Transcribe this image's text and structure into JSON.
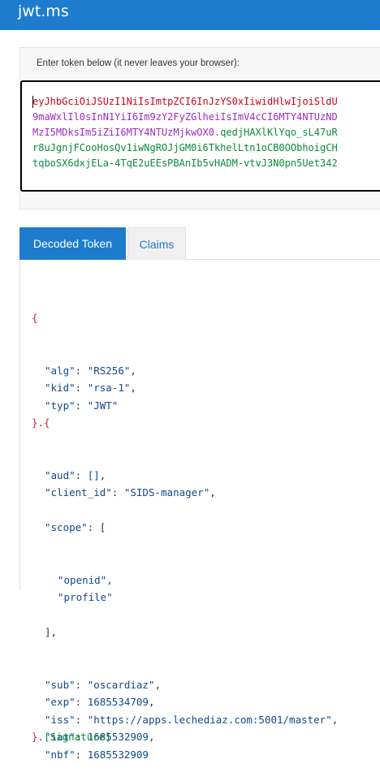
{
  "app": {
    "title": "jwt.ms"
  },
  "token": {
    "label": "Enter token below (it never leaves your browser):",
    "lines": [
      {
        "segments": [
          {
            "text": "eyJhbGciOiJSUzI1NiIsImtpZCI6InJzYS0xIiwidHlwIjoiSldU",
            "color": "red"
          }
        ]
      },
      {
        "segments": [
          {
            "text": "9maWxlIl0sInN1YiI6Im9zY2FyZGlheiIsImV4cCI6MTY4NTUzND",
            "color": "purple"
          }
        ]
      },
      {
        "segments": [
          {
            "text": "MzI5MDksIm5iZiI6MTY4NTUzMjkwOX0.",
            "color": "purple"
          },
          {
            "text": "qedjHAXlKlYqo_sL47uR",
            "color": "green"
          }
        ]
      },
      {
        "segments": [
          {
            "text": "r8uJgnjFCooHosQv1iwNgROJjGM0i6TkhelLtn1oCB0OObhoigCH",
            "color": "green"
          }
        ]
      },
      {
        "segments": [
          {
            "text": "tqboSX6dxjELa-4TqE2uEEsPBAnIb5vHADM-vtvJ3N0pn5Uet342",
            "color": "green"
          }
        ]
      }
    ]
  },
  "tabs": {
    "decoded": "Decoded Token",
    "claims": "Claims"
  },
  "decoded": {
    "open_brace": "{",
    "header": [
      {
        "key": "\"alg\"",
        "value": "\"RS256\"",
        "trail": ","
      },
      {
        "key": "\"kid\"",
        "value": "\"rsa-1\"",
        "trail": ","
      },
      {
        "key": "\"typ\"",
        "value": "\"JWT\"",
        "trail": ""
      }
    ],
    "header_close": "}.{",
    "payload_before_scope": [
      {
        "key": "\"aud\"",
        "value": "[]",
        "trail": ","
      },
      {
        "key": "\"client_id\"",
        "value": "\"SIDS-manager\"",
        "trail": ","
      }
    ],
    "scope_key": "\"scope\"",
    "scope_items": [
      "\"openid\",",
      "\"profile\""
    ],
    "scope_close": "],",
    "payload_after_scope": [
      {
        "key": "\"sub\"",
        "value": "\"oscardiaz\"",
        "trail": ","
      },
      {
        "key": "\"exp\"",
        "value": "1685534709",
        "trail": ","
      },
      {
        "key": "\"iss\"",
        "value": "\"https://apps.lechediaz.com:5001/master\"",
        "trail": ","
      },
      {
        "key": "\"iat\"",
        "value": "1685532909",
        "trail": ","
      },
      {
        "key": "\"nbf\"",
        "value": "1685532909",
        "trail": ""
      }
    ],
    "close_brace": "}.",
    "signature": "[Signature]"
  },
  "colors": {
    "accent": "#1e7ccf",
    "header_red": "#d0021b",
    "payload_purple": "#9b2bbf",
    "signature_green": "#0a8a3c"
  }
}
